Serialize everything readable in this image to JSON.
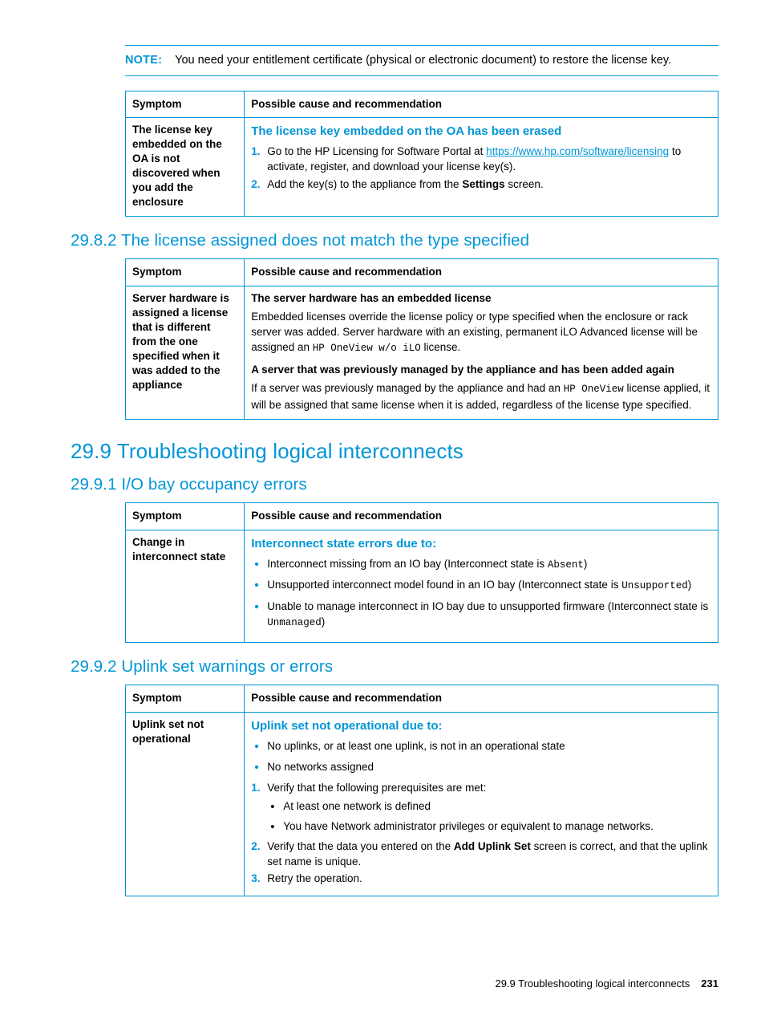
{
  "note": {
    "label": "NOTE:",
    "text": "You need your entitlement certificate (physical or electronic document) to restore the license key."
  },
  "table_headers": {
    "symptom": "Symptom",
    "cause": "Possible cause and recommendation"
  },
  "table1": {
    "symptom": "The license key embedded on the OA is not discovered when you add the enclosure",
    "heading": "The license key embedded on the OA has been erased",
    "steps": [
      {
        "pre": "Go to the HP Licensing for Software Portal at ",
        "link": "https://www.hp.com/software/licensing",
        "post": " to activate, register, and download your license key(s)."
      },
      {
        "pre": "Add the key(s) to the appliance from the ",
        "bold": "Settings",
        "post": " screen."
      }
    ]
  },
  "section_29_8_2": {
    "number": "29.8.2",
    "title": "The license assigned does not match the type specified"
  },
  "table2": {
    "symptom": "Server hardware is assigned a license that is different from the one specified when it was added to the appliance",
    "head1": "The server hardware has an embedded license",
    "para1_a": "Embedded licenses override the license policy or type specified when the enclosure or rack server was added. Server hardware with an existing, permanent iLO Advanced license will be assigned an ",
    "para1_mono": "HP OneView w/o iLO",
    "para1_b": " license.",
    "head2": "A server that was previously managed by the appliance and has been added again",
    "para2_a": "If a server was previously managed by the appliance and had an ",
    "para2_mono": "HP OneView",
    "para2_b": " license applied, it will be assigned that same license when it is added, regardless of the license type specified."
  },
  "section_29_9": {
    "number": "29.9",
    "title": "Troubleshooting logical interconnects"
  },
  "section_29_9_1": {
    "number": "29.9.1",
    "title": "I/O bay occupancy errors"
  },
  "table3": {
    "symptom": "Change in interconnect state",
    "heading": "Interconnect state errors due to:",
    "bullets": [
      {
        "pre": "Interconnect missing from an IO bay (Interconnect state is ",
        "mono": "Absent",
        "post": ")"
      },
      {
        "pre": "Unsupported interconnect model found in an IO bay (Interconnect state is ",
        "mono": "Unsupported",
        "post": ")"
      },
      {
        "pre": "Unable to manage interconnect in IO bay due to unsupported firmware (Interconnect state is ",
        "mono": "Unmanaged",
        "post": ")"
      }
    ]
  },
  "section_29_9_2": {
    "number": "29.9.2",
    "title": "Uplink set warnings or errors"
  },
  "table4": {
    "symptom": "Uplink set not operational",
    "heading": "Uplink set not operational due to:",
    "bullets": [
      "No uplinks, or at least one uplink, is not in an operational state",
      "No networks assigned"
    ],
    "step1_text": "Verify that the following prerequisites are met:",
    "step1_subbullets": [
      "At least one network is defined",
      "You have Network administrator privileges or equivalent to manage networks."
    ],
    "step2_pre": "Verify that the data you entered on the ",
    "step2_bold": "Add Uplink Set",
    "step2_post": " screen is correct, and that the uplink set name is unique.",
    "step3_text": "Retry the operation."
  },
  "footer": {
    "text": "29.9 Troubleshooting logical interconnects",
    "page": "231"
  }
}
